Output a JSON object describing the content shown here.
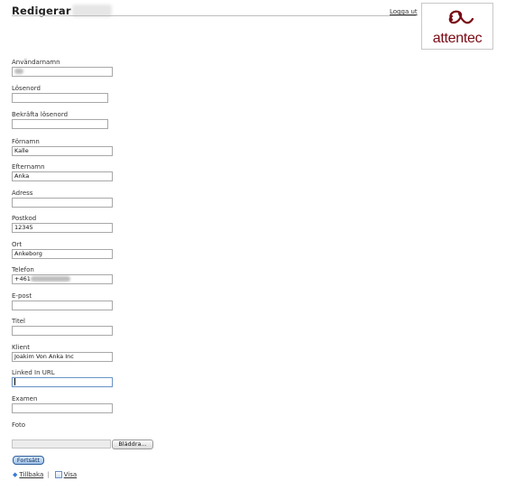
{
  "header": {
    "title": "Redigerar",
    "logout_label": "Logga ut",
    "logo_text": "attentec",
    "brand_color": "#7a0a14"
  },
  "form": {
    "fields": {
      "username": {
        "label": "Användarnamn",
        "value": ""
      },
      "password": {
        "label": "Lösenord",
        "value": ""
      },
      "confirm_password": {
        "label": "Bekräfta lösenord",
        "value": ""
      },
      "first_name": {
        "label": "Förnamn",
        "value": "Kalle"
      },
      "last_name": {
        "label": "Efternamn",
        "value": "Anka"
      },
      "address": {
        "label": "Adress",
        "value": ""
      },
      "postal_code": {
        "label": "Postkod",
        "value": "12345"
      },
      "city": {
        "label": "Ort",
        "value": "Ankeborg"
      },
      "phone": {
        "label": "Telefon",
        "value_prefix": "+461"
      },
      "email": {
        "label": "E-post",
        "value": ""
      },
      "title": {
        "label": "Titel",
        "value": ""
      },
      "client": {
        "label": "Klient",
        "value": "Joakim Von Anka Inc"
      },
      "linkedin": {
        "label": "Linked In URL",
        "value": ""
      },
      "degree": {
        "label": "Examen",
        "value": ""
      },
      "photo": {
        "label": "Foto",
        "browse_label": "Bläddra..."
      }
    },
    "submit_label": "Fortsätt"
  },
  "footer": {
    "back_label": "Tillbaka",
    "separator": "|",
    "view_label": "Visa"
  },
  "icons": {
    "back": "arrow-left-icon",
    "view": "document-icon"
  }
}
